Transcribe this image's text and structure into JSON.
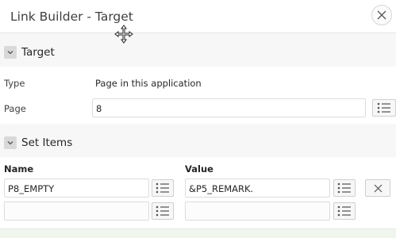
{
  "dialog": {
    "title": "Link Builder - Target"
  },
  "target_region": {
    "title": "Target",
    "type_label": "Type",
    "type_value": "Page in this application",
    "page_label": "Page",
    "page_value": "8"
  },
  "set_items_region": {
    "title": "Set Items",
    "name_header": "Name",
    "value_header": "Value",
    "rows": [
      {
        "name": "P8_EMPTY",
        "value": "&P5_REMARK."
      },
      {
        "name": "",
        "value": ""
      }
    ]
  }
}
